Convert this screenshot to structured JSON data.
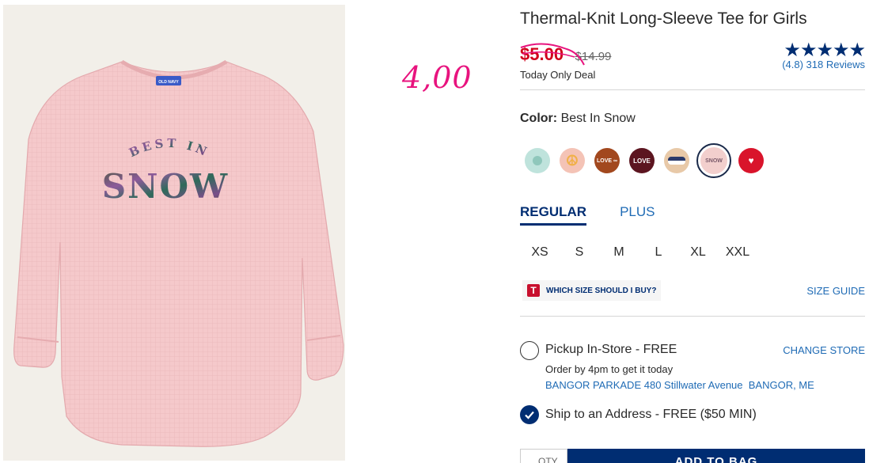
{
  "product": {
    "title": "Thermal-Knit Long-Sleeve Tee for Girls",
    "shirt_graphic_top": "BEST IN",
    "shirt_graphic_main": "SNOW",
    "shirt_tag": "OLD NAVY"
  },
  "annotation": {
    "handwritten_price": "4,00",
    "color": "#e8137e"
  },
  "price": {
    "sale": "$5.00",
    "original": "$14.99",
    "deal_label": "Today Only Deal",
    "sale_color": "#d0011b"
  },
  "rating": {
    "stars": "★★★★★",
    "value": 4.8,
    "text": "(4.8) 318 Reviews"
  },
  "color": {
    "label": "Color:",
    "selected": "Best In Snow",
    "swatches": [
      {
        "name": "swatch-mint",
        "bg": "#bfe3dc",
        "text": ""
      },
      {
        "name": "swatch-peace",
        "bg": "#f4c3b6",
        "text": "☮"
      },
      {
        "name": "swatch-love-infinity",
        "bg": "#a2481e",
        "text": "LOVE ∞"
      },
      {
        "name": "swatch-love",
        "bg": "#5c1520",
        "text": "LOVE"
      },
      {
        "name": "swatch-landscape",
        "bg": "#e8c9a8",
        "text": ""
      },
      {
        "name": "swatch-best-in-snow",
        "bg": "#f2cfcd",
        "text": "SNOW"
      },
      {
        "name": "swatch-red",
        "bg": "#d9142b",
        "text": "♥"
      }
    ]
  },
  "fit": {
    "tabs": [
      "REGULAR",
      "PLUS"
    ],
    "active": "REGULAR"
  },
  "sizes": [
    "XS",
    "S",
    "M",
    "L",
    "XL",
    "XXL"
  ],
  "size_help": {
    "icon_letter": "T",
    "text": "WHICH SIZE SHOULD I BUY?",
    "guide_link": "SIZE GUIDE"
  },
  "pickup": {
    "label": "Pickup In-Store - FREE",
    "change_store": "CHANGE STORE",
    "order_by": "Order by 4pm to get it today",
    "address": "BANGOR PARKADE 480 Stillwater Avenue  BANGOR, ME"
  },
  "ship": {
    "label": "Ship to an Address - FREE ($50 MIN)",
    "checked": true
  },
  "cart": {
    "qty": "QTY",
    "add_button": "ADD TO BAG"
  }
}
